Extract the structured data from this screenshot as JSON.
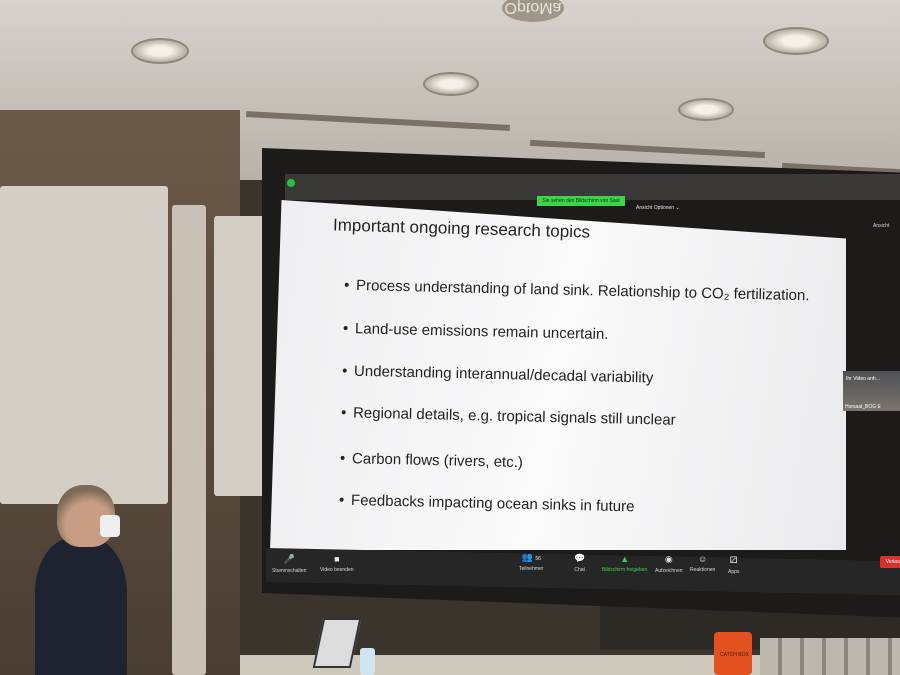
{
  "projector_label": "OptoMa",
  "zoom": {
    "sharing_banner": "Sie sehen den Bildschirm von Saal",
    "view_options": "Ansicht Optionen ⌄",
    "view_right": "Ansicht",
    "participant": {
      "label": "Ihr Video anh…",
      "name": "Horsaal_BOG E"
    },
    "toolbar": [
      {
        "icon": "microphone-icon",
        "glyph": "🎤",
        "label": "Stummschalten"
      },
      {
        "icon": "video-camera-icon",
        "glyph": "■",
        "label": "Video beenden"
      },
      {
        "icon": "participants-icon",
        "glyph": "👥",
        "label": "Teilnehmer",
        "count": "56"
      },
      {
        "icon": "chat-icon",
        "glyph": "💬",
        "label": "Chat"
      },
      {
        "icon": "share-screen-icon",
        "glyph": "▲",
        "label": "Bildschirm freigeben",
        "color": "#3cd54a"
      },
      {
        "icon": "record-icon",
        "glyph": "◉",
        "label": "Aufzeichnen"
      },
      {
        "icon": "reactions-icon",
        "glyph": "☺",
        "label": "Reaktionen"
      },
      {
        "icon": "apps-icon",
        "glyph": "⚂",
        "label": "Apps"
      }
    ],
    "leave_label": "Verlass"
  },
  "slide": {
    "title": "Important ongoing research topics",
    "bullets": [
      "Process understanding of land sink.  Relationship to CO₂ fertilization.",
      "Land-use emissions remain uncertain.",
      "Understanding interannual/decadal variability",
      "Regional details, e.g. tropical signals still unclear",
      "Carbon flows (rivers, etc.)",
      "Feedbacks impacting ocean sinks in future"
    ]
  },
  "speaker_box_text": "CATCH BOX"
}
